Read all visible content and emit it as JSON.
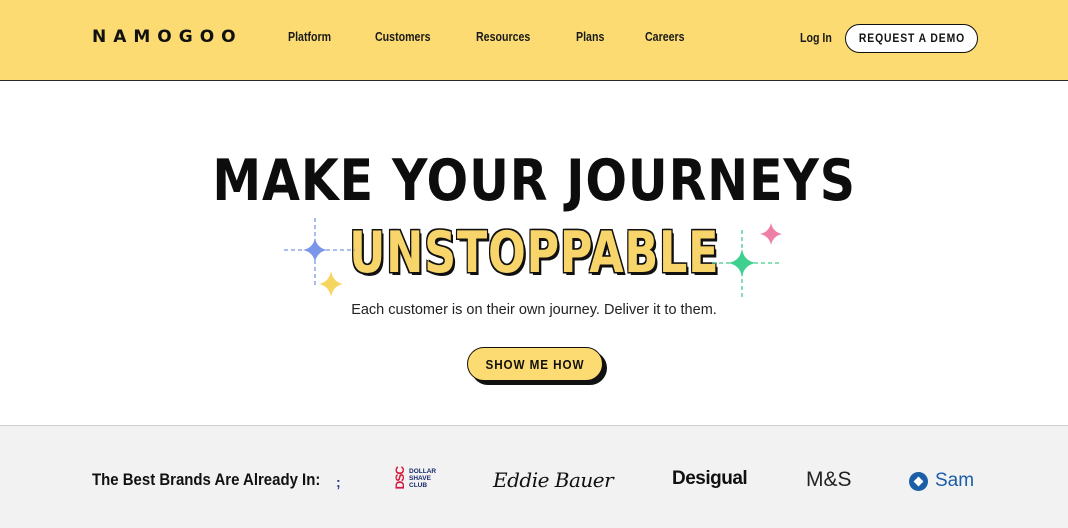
{
  "header": {
    "logo": "NAMOGOO",
    "nav": [
      "Platform",
      "Customers",
      "Resources",
      "Plans",
      "Careers"
    ],
    "login_label": "Log In",
    "demo_label": "REQUEST A DEMO"
  },
  "hero": {
    "title": "MAKE YOUR JOURNEYS",
    "highlight": "UNSTOPPABLE",
    "tagline": "Each customer is on their own journey. Deliver it to them.",
    "cta_label": "SHOW ME HOW"
  },
  "brands": {
    "label": "The Best Brands Are Already In:",
    "separator": ";",
    "logos": {
      "dsc_mark": "DSC",
      "dsc_text": "DOLLAR SHAVE CLUB",
      "eddie": "Eddie Bauer",
      "desigual": "Desigual",
      "ms": "M&S",
      "sams": "Sam"
    }
  },
  "colors": {
    "brand_yellow": "#fbdb72",
    "sparkle_blue": "#7a96e8",
    "sparkle_green": "#3fcf8e",
    "sparkle_pink": "#ee7fa6",
    "sparkle_yellow": "#f5d65f"
  }
}
